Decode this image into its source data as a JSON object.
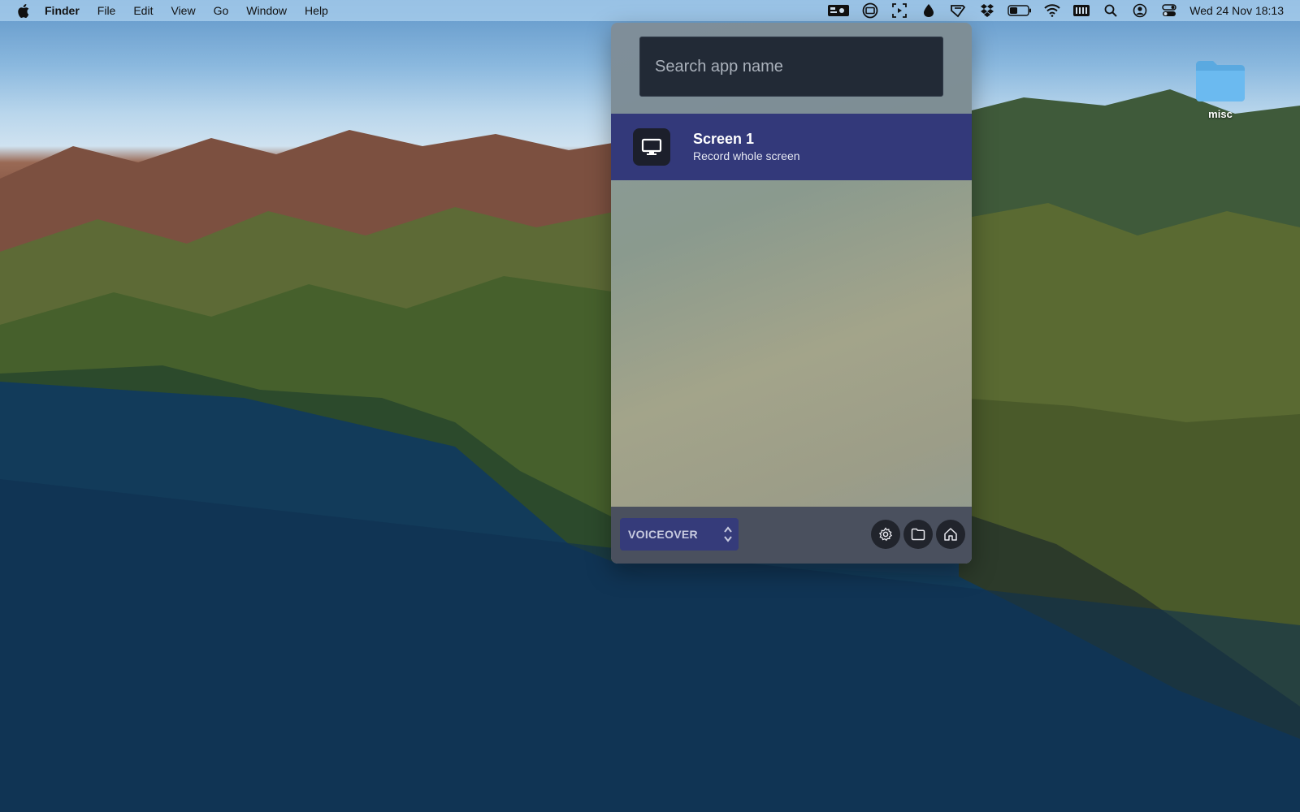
{
  "menubar": {
    "app_name": "Finder",
    "menus": [
      "File",
      "Edit",
      "View",
      "Go",
      "Window",
      "Help"
    ],
    "tray_icons": [
      "recorder-icon",
      "screen-share-icon",
      "screenshot-icon",
      "drop-icon",
      "tag-icon",
      "dropbox-icon",
      "battery-icon",
      "wifi-icon",
      "keyboard-icon",
      "search-icon",
      "user-icon",
      "control-center-icon"
    ],
    "clock": "Wed 24 Nov  18:13"
  },
  "desktop": {
    "folder_label": "misc"
  },
  "recorder": {
    "search_placeholder": "Search app name",
    "sources": [
      {
        "title": "Screen 1",
        "subtitle": "Record whole screen",
        "icon": "monitor-icon"
      }
    ],
    "mode": "VOICEOVER",
    "footer_buttons": [
      "settings-icon",
      "folder-icon",
      "home-icon"
    ]
  },
  "colors": {
    "selected_row": "#33397a",
    "search_bg": "#222a36",
    "footer_bg": "#4a505e"
  }
}
